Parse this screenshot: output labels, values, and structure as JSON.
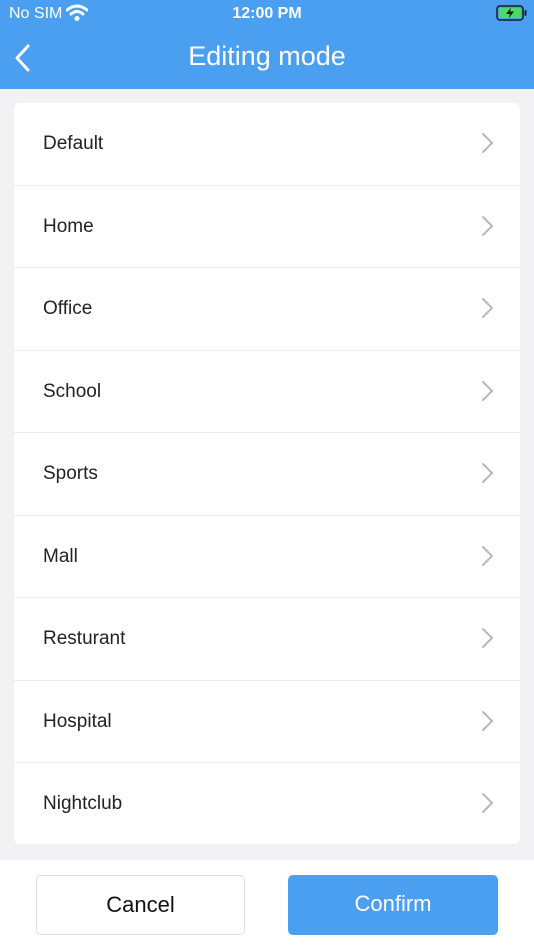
{
  "status_bar": {
    "carrier": "No SIM",
    "time": "12:00 PM",
    "wifi_icon": "wifi-icon",
    "battery_icon": "battery-charging-icon"
  },
  "header": {
    "title": "Editing mode",
    "back_icon": "chevron-left-icon"
  },
  "modes": [
    {
      "label": "Default"
    },
    {
      "label": "Home"
    },
    {
      "label": "Office"
    },
    {
      "label": "School"
    },
    {
      "label": "Sports"
    },
    {
      "label": "Mall"
    },
    {
      "label": "Resturant"
    },
    {
      "label": "Hospital"
    },
    {
      "label": "Nightclub"
    }
  ],
  "footer": {
    "cancel_label": "Cancel",
    "confirm_label": "Confirm"
  },
  "colors": {
    "accent": "#4a9ff0",
    "background": "#f2f2f4"
  }
}
